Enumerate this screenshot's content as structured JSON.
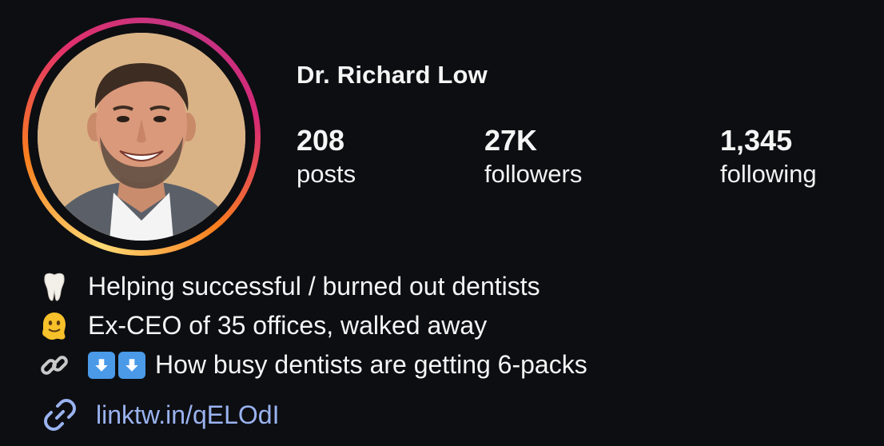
{
  "profile": {
    "name": "Dr. Richard Low",
    "avatar": "profile-photo"
  },
  "stats": [
    {
      "value": "208",
      "label": "posts"
    },
    {
      "value": "27K",
      "label": "followers"
    },
    {
      "value": "1,345",
      "label": "following"
    }
  ],
  "bio": {
    "lines": [
      {
        "icon": "tooth-icon",
        "text": "Helping successful / burned out dentists"
      },
      {
        "icon": "melting-face-icon",
        "text": "Ex-CEO of 35 offices, walked away"
      },
      {
        "icon": "link-chain-icon",
        "text": "How busy dentists are getting 6-packs"
      }
    ]
  },
  "link": {
    "icon": "link-icon",
    "text": "linktw.in/qELOdI"
  },
  "colors": {
    "background": "#0d0e12",
    "link": "#9ab3f0",
    "ring_gradient": [
      "#feda75",
      "#fa7e1e",
      "#e1306c",
      "#c13584"
    ]
  }
}
